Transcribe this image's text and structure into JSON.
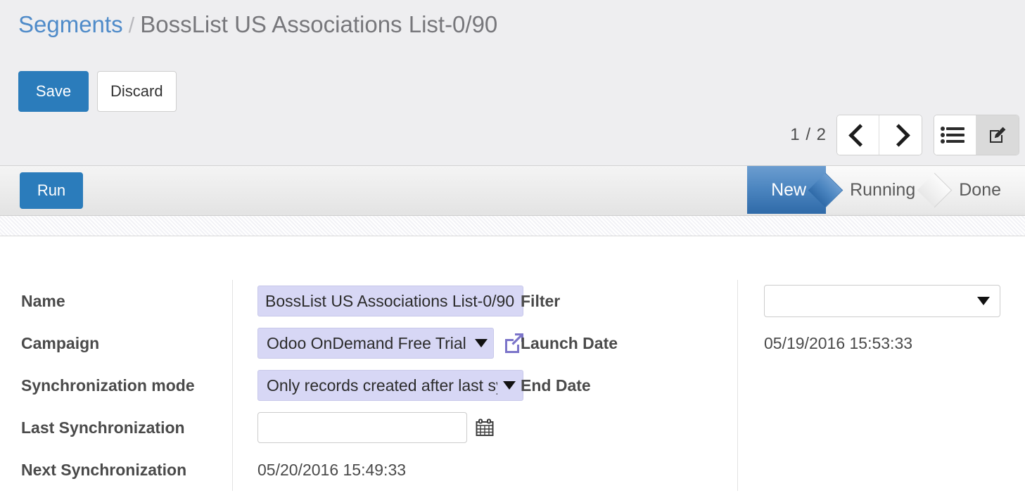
{
  "breadcrumb": {
    "root": "Segments",
    "separator": "/",
    "current": "BossList US Associations List-0/90"
  },
  "toolbar": {
    "save_label": "Save",
    "discard_label": "Discard"
  },
  "pager": {
    "counter": "1 / 2",
    "prev_icon": "chevron-left-icon",
    "next_icon": "chevron-right-icon"
  },
  "view_switcher": {
    "list_icon": "list-view-icon",
    "form_icon": "form-edit-icon",
    "active": "form"
  },
  "statusbar": {
    "run_label": "Run",
    "stages": [
      {
        "label": "New",
        "active": true
      },
      {
        "label": "Running",
        "active": false
      },
      {
        "label": "Done",
        "active": false
      }
    ]
  },
  "form": {
    "left": [
      {
        "label": "Name",
        "value": "BossList US Associations List-0/90",
        "widget": "input-required"
      },
      {
        "label": "Campaign",
        "value": "Odoo OnDemand Free Trial",
        "widget": "select-required",
        "external_link_icon": "external-link-icon"
      },
      {
        "label": "Synchronization mode",
        "value": "Only records created after last sync",
        "widget": "select-required"
      },
      {
        "label": "Last Synchronization",
        "value": "",
        "widget": "input-date",
        "calendar_icon": "calendar-icon"
      },
      {
        "label": "Next Synchronization",
        "value": "05/20/2016 15:49:33",
        "widget": "readonly"
      }
    ],
    "right": [
      {
        "label": "Filter",
        "value": "",
        "widget": "select"
      },
      {
        "label": "Launch Date",
        "value": "05/19/2016 15:53:33",
        "widget": "readonly"
      },
      {
        "label": "End Date",
        "value": "",
        "widget": "readonly"
      }
    ]
  },
  "colors": {
    "primary": "#2b7cbb",
    "link": "#4f8bc9",
    "header_bg": "#eeeef0",
    "required_field_bg": "#d7d7f5",
    "stage_active_start": "#6c9dd0",
    "stage_active_end": "#2f6aa8"
  }
}
